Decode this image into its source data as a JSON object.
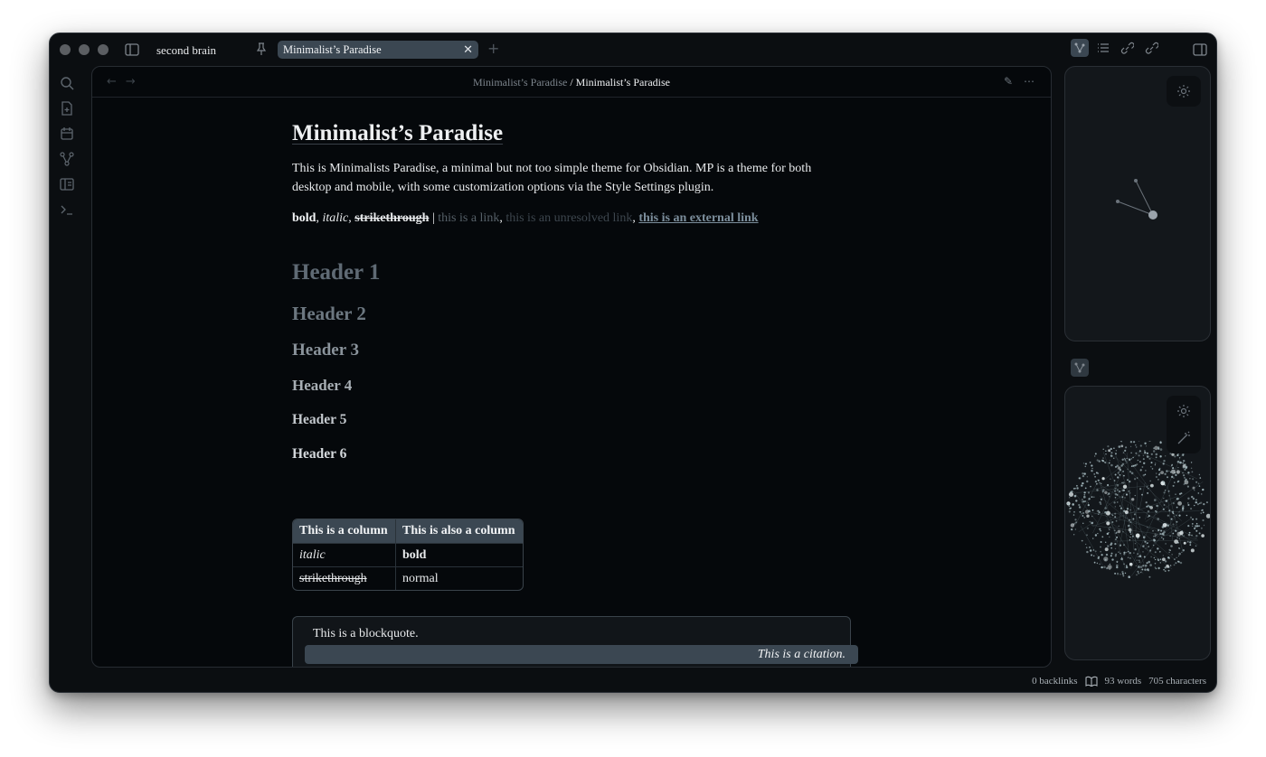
{
  "window": {
    "vault_name": "second brain",
    "tab_title": "Minimalist’s Paradise",
    "tab_close": "✕",
    "new_tab": "+"
  },
  "breadcrumb": {
    "parent": "Minimalist’s Paradise",
    "separator": "/",
    "current": "Minimalist’s Paradise"
  },
  "nav": {
    "back": "←",
    "forward": "→"
  },
  "view_actions": {
    "edit": "✎",
    "more": "⋯"
  },
  "document": {
    "title": "Minimalist’s Paradise",
    "intro": "This is Minimalists Paradise, a minimal but not too simple theme for Obsidian. MP is a theme for both desktop and mobile, with some customization options via the Style Settings plugin.",
    "inline": {
      "bold": "bold",
      "italic": "italic",
      "strike": "strikethrough",
      "cursor": "|",
      "link": "this is a link",
      "unresolved": "this is an unresolved link",
      "external": "this is an external link",
      "comma": ", "
    },
    "headers": [
      "Header 1",
      "Header 2",
      "Header 3",
      "Header 4",
      "Header 5",
      "Header 6"
    ],
    "table": {
      "headers": [
        "This is a column",
        "This is also a column"
      ],
      "rows": [
        [
          "italic",
          "bold"
        ],
        [
          "strikethrough",
          "normal"
        ]
      ]
    },
    "blockquote": {
      "text": "This is a blockquote.",
      "citation": "This is a citation."
    }
  },
  "status": {
    "backlinks": "0 backlinks",
    "words": "93 words",
    "characters": "705 characters"
  },
  "colors": {
    "background": "#05080b",
    "accent": "#3b4752",
    "text": "#e8eaec",
    "graph_nodes": "#9fb3b8"
  }
}
